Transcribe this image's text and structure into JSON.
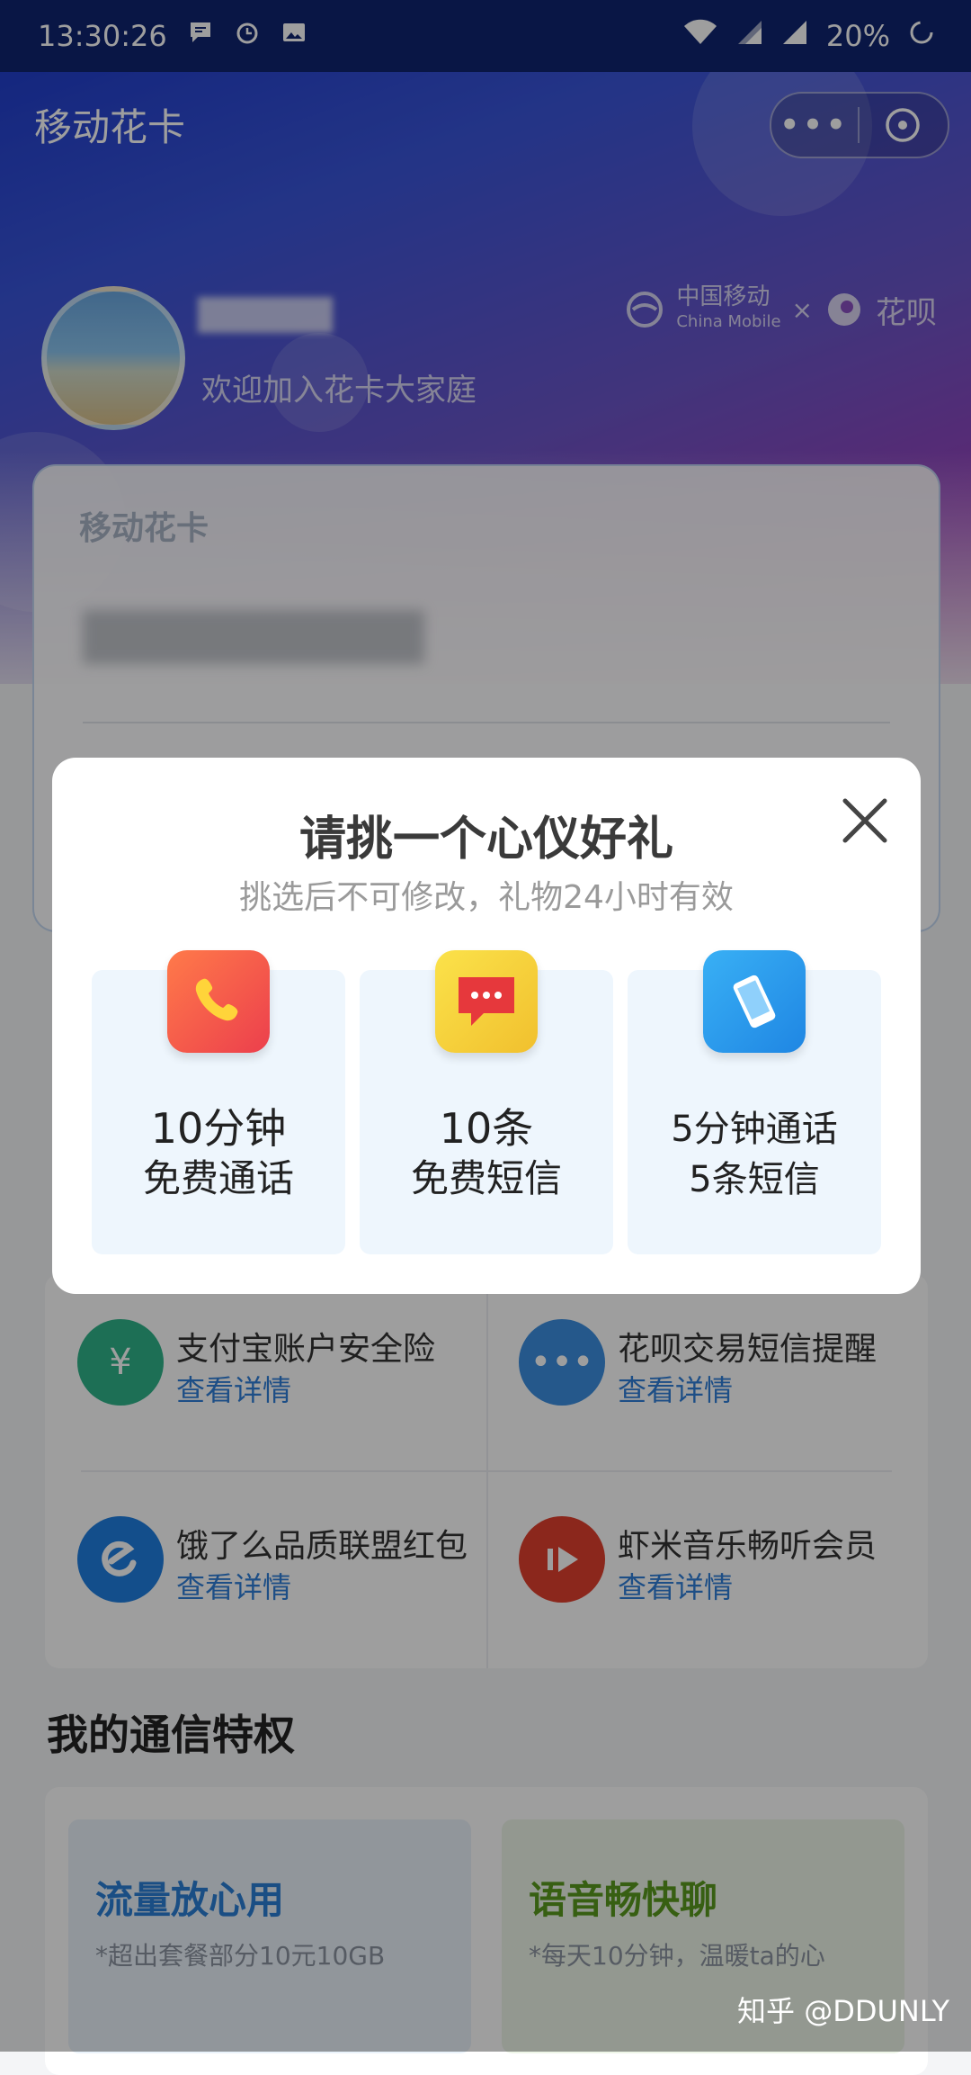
{
  "status_bar": {
    "time": "13:30:26",
    "battery": "20%",
    "icons": [
      "message-icon",
      "alarm-icon",
      "image-icon",
      "wifi-icon",
      "signal-icon",
      "signal-icon",
      "battery-loading-icon"
    ]
  },
  "header": {
    "title": "移动花卡",
    "more_label": "•••"
  },
  "profile": {
    "welcome": "欢迎加入花卡大家庭",
    "brand_cm": "中国移动",
    "brand_cm_en": "China Mobile",
    "brand_x": "×",
    "brand_huabei": "花呗"
  },
  "card": {
    "title": "移动花卡"
  },
  "modal": {
    "title": "请挑一个心仪好礼",
    "subtitle": "挑选后不可修改，礼物24小时有效",
    "options": [
      {
        "line1": "10分钟",
        "line2": "免费通话",
        "icon": "phone-icon",
        "color": "#f0604b"
      },
      {
        "line1": "10条",
        "line2": "免费短信",
        "icon": "message-icon",
        "color": "#f4d23c"
      },
      {
        "line1": "5分钟通话",
        "line2": "5条短信",
        "icon": "mobile-icon",
        "color": "#3aa0ef"
      }
    ]
  },
  "benefits": [
    {
      "name": "支付宝账户安全险",
      "link": "查看详情",
      "icon": "yen-shield-icon",
      "color": "#2fb38a"
    },
    {
      "name": "花呗交易短信提醒",
      "link": "查看详情",
      "icon": "chat-bubble-icon",
      "color": "#3d8fe0"
    },
    {
      "name": "饿了么品质联盟红包",
      "link": "查看详情",
      "icon": "eleme-icon",
      "color": "#1f7fe0"
    },
    {
      "name": "虾米音乐畅听会员",
      "link": "查看详情",
      "icon": "xiami-icon",
      "color": "#e0402e"
    }
  ],
  "privileges": {
    "title": "我的通信特权",
    "items": [
      {
        "title": "流量放心用",
        "desc": "*超出套餐部分10元10GB",
        "color": "#2a7fd6"
      },
      {
        "title": "语音畅快聊",
        "desc": "*每天10分钟，温暖ta的心",
        "color": "#5a9a1e"
      }
    ]
  },
  "watermark": "知乎 @DDUNLY"
}
